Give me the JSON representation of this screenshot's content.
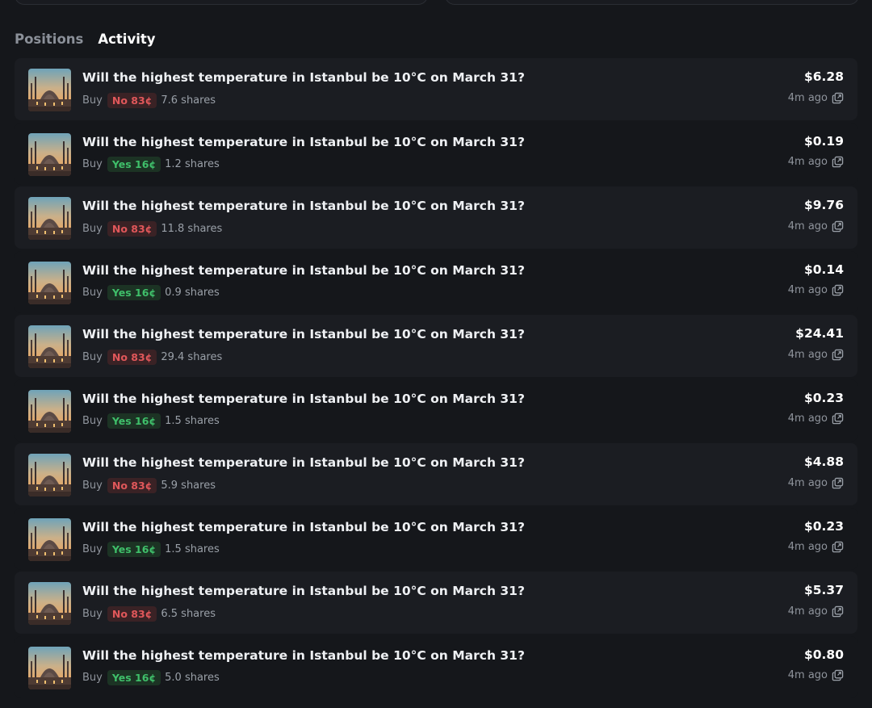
{
  "tabs": [
    {
      "label": "Positions",
      "active": false
    },
    {
      "label": "Activity",
      "active": true
    }
  ],
  "colors": {
    "no_text": "#e0575a",
    "no_bg": "#3a2225",
    "yes_text": "#3fbf6a",
    "yes_bg": "#1c3324",
    "row_alt_bg": "#1b1d22",
    "page_bg": "#15171b"
  },
  "activity": [
    {
      "title": "Will the highest temperature in Istanbul be 10°C on March 31?",
      "side": "Buy",
      "outcome": "no",
      "outcome_label": "No 83¢",
      "shares": "7.6 shares",
      "amount": "$6.28",
      "time": "4m ago",
      "icon": "external-link-icon"
    },
    {
      "title": "Will the highest temperature in Istanbul be 10°C on March 31?",
      "side": "Buy",
      "outcome": "yes",
      "outcome_label": "Yes 16¢",
      "shares": "1.2 shares",
      "amount": "$0.19",
      "time": "4m ago",
      "icon": "external-link-icon"
    },
    {
      "title": "Will the highest temperature in Istanbul be 10°C on March 31?",
      "side": "Buy",
      "outcome": "no",
      "outcome_label": "No 83¢",
      "shares": "11.8 shares",
      "amount": "$9.76",
      "time": "4m ago",
      "icon": "external-link-icon"
    },
    {
      "title": "Will the highest temperature in Istanbul be 10°C on March 31?",
      "side": "Buy",
      "outcome": "yes",
      "outcome_label": "Yes 16¢",
      "shares": "0.9 shares",
      "amount": "$0.14",
      "time": "4m ago",
      "icon": "external-link-icon"
    },
    {
      "title": "Will the highest temperature in Istanbul be 10°C on March 31?",
      "side": "Buy",
      "outcome": "no",
      "outcome_label": "No 83¢",
      "shares": "29.4 shares",
      "amount": "$24.41",
      "time": "4m ago",
      "icon": "external-link-icon"
    },
    {
      "title": "Will the highest temperature in Istanbul be 10°C on March 31?",
      "side": "Buy",
      "outcome": "yes",
      "outcome_label": "Yes 16¢",
      "shares": "1.5 shares",
      "amount": "$0.23",
      "time": "4m ago",
      "icon": "external-link-icon"
    },
    {
      "title": "Will the highest temperature in Istanbul be 10°C on March 31?",
      "side": "Buy",
      "outcome": "no",
      "outcome_label": "No 83¢",
      "shares": "5.9 shares",
      "amount": "$4.88",
      "time": "4m ago",
      "icon": "external-link-icon"
    },
    {
      "title": "Will the highest temperature in Istanbul be 10°C on March 31?",
      "side": "Buy",
      "outcome": "yes",
      "outcome_label": "Yes 16¢",
      "shares": "1.5 shares",
      "amount": "$0.23",
      "time": "4m ago",
      "icon": "external-link-icon"
    },
    {
      "title": "Will the highest temperature in Istanbul be 10°C on March 31?",
      "side": "Buy",
      "outcome": "no",
      "outcome_label": "No 83¢",
      "shares": "6.5 shares",
      "amount": "$5.37",
      "time": "4m ago",
      "icon": "external-link-icon"
    },
    {
      "title": "Will the highest temperature in Istanbul be 10°C on March 31?",
      "side": "Buy",
      "outcome": "yes",
      "outcome_label": "Yes 16¢",
      "shares": "5.0 shares",
      "amount": "$0.80",
      "time": "4m ago",
      "icon": "external-link-icon"
    }
  ]
}
